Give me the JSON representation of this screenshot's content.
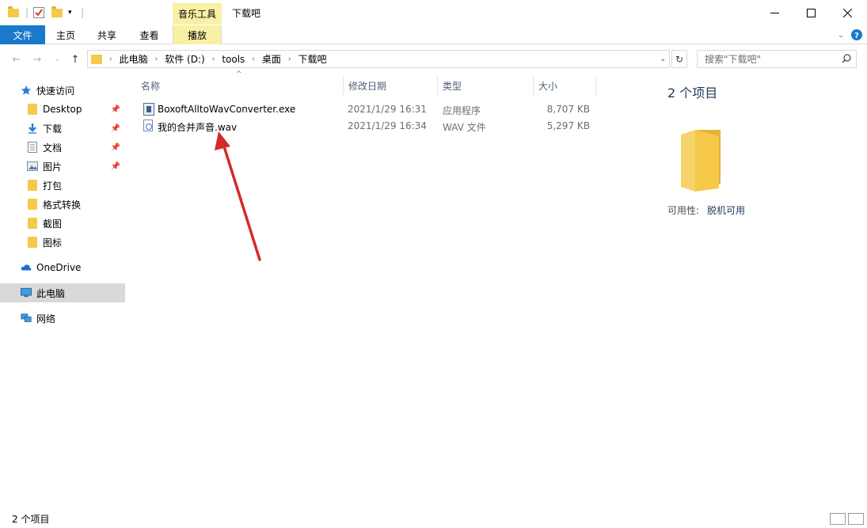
{
  "window": {
    "title": "下载吧",
    "contextual_tab_group": "音乐工具"
  },
  "ribbon": {
    "tabs": [
      "文件",
      "主页",
      "共享",
      "查看",
      "播放"
    ]
  },
  "address": {
    "crumbs": [
      "此电脑",
      "软件 (D:)",
      "tools",
      "桌面",
      "下载吧"
    ],
    "search_placeholder": "搜索\"下载吧\""
  },
  "sidebar": {
    "quick_access": "快速访问",
    "pinned": [
      "Desktop",
      "下载",
      "文档",
      "图片"
    ],
    "folders": [
      "打包",
      "格式转换",
      "截图",
      "图标"
    ],
    "onedrive": "OneDrive",
    "this_pc": "此电脑",
    "network": "网络"
  },
  "columns": {
    "name": "名称",
    "date": "修改日期",
    "type": "类型",
    "size": "大小"
  },
  "files": [
    {
      "name": "BoxoftAlltoWavConverter.exe",
      "date": "2021/1/29 16:31",
      "type": "应用程序",
      "size": "8,707 KB",
      "icon": "exe-icon"
    },
    {
      "name": "我的合并声音.wav",
      "date": "2021/1/29 16:34",
      "type": "WAV 文件",
      "size": "5,297 KB",
      "icon": "wav-icon"
    }
  ],
  "details": {
    "count": "2 个项目",
    "availability_label": "可用性:",
    "availability_value": "脱机可用"
  },
  "status": {
    "count": "2 个项目"
  },
  "colors": {
    "file_tab": "#1979ca",
    "tool_tab": "#f8f1a5",
    "selected_nav": "#d9d9d9",
    "annotation_arrow": "#d42a2a"
  }
}
